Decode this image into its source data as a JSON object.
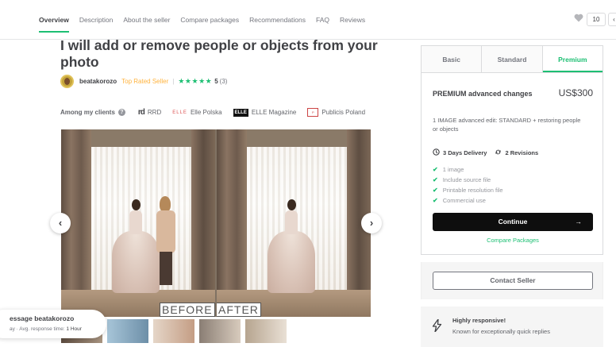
{
  "nav": {
    "tabs": [
      "Overview",
      "Description",
      "About the seller",
      "Compare packages",
      "Recommendations",
      "FAQ",
      "Reviews"
    ],
    "save_count": "10",
    "share_label": "‹"
  },
  "gig": {
    "title": "I will add or remove people or objects from your photo",
    "seller_name": "beatakorozo",
    "badge": "Top Rated Seller",
    "divider": "|",
    "stars": "★★★★★",
    "rating": "5",
    "review_count": "(3)"
  },
  "clients": {
    "label": "Among my clients",
    "help": "?",
    "items": [
      {
        "logo": "rd",
        "name": "RRD"
      },
      {
        "logo": "ELLE",
        "name": "Elle Polska"
      },
      {
        "logo": "ELLE",
        "name": "ELLE Magazine"
      },
      {
        "logo": "P",
        "name": "Publicis Poland"
      }
    ]
  },
  "gallery": {
    "before_label": "BEFORE",
    "after_label": "AFTER",
    "prev_icon": "‹",
    "next_icon": "›"
  },
  "chat": {
    "title": "essage beatakorozo",
    "sub_prefix": "ay · Avg. response time: ",
    "sub_value": "1 Hour"
  },
  "packages": {
    "tabs": [
      "Basic",
      "Standard",
      "Premium"
    ],
    "active_tab": "Premium",
    "name": "PREMIUM advanced changes",
    "price": "US$300",
    "description": "1 IMAGE advanced edit: STANDARD + restoring people or objects",
    "delivery": "3 Days Delivery",
    "revisions": "2 Revisions",
    "features": [
      "1 image",
      "Include source file",
      "Printable resolution file",
      "Commercial use"
    ],
    "continue_label": "Continue",
    "continue_arrow": "→",
    "compare_label": "Compare Packages"
  },
  "contact": {
    "button_label": "Contact Seller"
  },
  "responsive": {
    "title": "Highly responsive!",
    "subtitle": "Known for exceptionally quick replies"
  },
  "colors": {
    "accent": "#1dbf73",
    "badge": "#ffb33e",
    "dark_button": "#0e0e0e"
  }
}
